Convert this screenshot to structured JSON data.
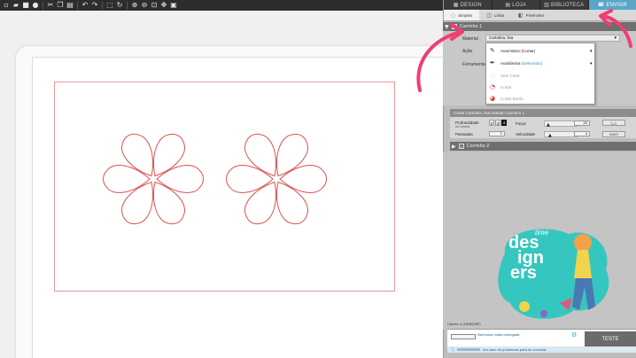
{
  "toolbar": {
    "icons": [
      "new-document-icon",
      "open-folder-icon",
      "save-icon",
      "chat-icon",
      "cut-icon",
      "copy-icon",
      "paste-icon",
      "undo-icon",
      "redo-icon",
      "select-icon",
      "zoom-in-icon",
      "zoom-out-icon",
      "zoom-fit-icon",
      "pan-icon",
      "zoom-window-icon"
    ]
  },
  "tabs": [
    {
      "label": "DESIGN",
      "icon": "grid-icon"
    },
    {
      "label": "LOJA",
      "icon": "store-icon"
    },
    {
      "label": "BIBLIOTECA",
      "icon": "library-icon"
    },
    {
      "label": "ENVIAR",
      "icon": "send-icon"
    }
  ],
  "subtabs": [
    {
      "label": "Simples"
    },
    {
      "label": "Linha"
    },
    {
      "label": "Preencher"
    }
  ],
  "carrinho1": {
    "title": "Carrinho 1",
    "material_label": "Material",
    "material_value": "Cartolina, lisa",
    "acao_label": "Ação",
    "ferramenta_label": "Ferramenta",
    "dropdown": {
      "option1": "Automático (Cortar)",
      "option2": "Autolâmina",
      "option2_detected": "(Detectado)",
      "option3": "Sem Corte",
      "option4": "Cortar",
      "option5": "Cortar Borda"
    }
  },
  "settings": {
    "strip": "Cortar Cartolina, lisa Usando Carrinho 1",
    "profundidade_label": "Profundidade",
    "profundidade_sub": "da Lâmina",
    "blade_values": [
      "2",
      "3",
      "4"
    ],
    "forca_label": "Força",
    "forca_value": "20",
    "passadas_label": "Passadas",
    "passadas_value": "1",
    "velocidade_label": "Velocidade",
    "velocidade_value": "4",
    "mais_label": "MAIS"
  },
  "carrinho2": {
    "title": "Carrinho 2"
  },
  "status": {
    "mat_label": "Cameo 4 (1998CMF)",
    "media_label": "Nenhuma mídia carregada"
  },
  "test_button": "TESTE",
  "info_bar": "em caso de problemas para se conectar.",
  "logo": {
    "top": "time",
    "line1": "des",
    "line2": "ign",
    "line3": "ers"
  },
  "colors": {
    "accent": "#59a6c9",
    "cut_line": "#d9534f",
    "arrow": "#ee3e72",
    "logo_teal": "#35c7bf"
  }
}
